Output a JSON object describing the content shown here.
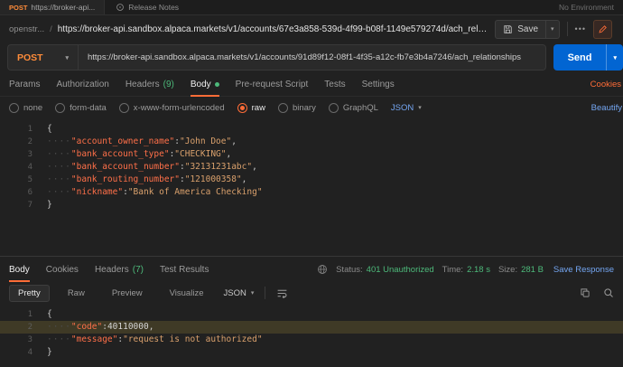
{
  "colors": {
    "accent_orange": "#ff6c37",
    "method_post": "#ff8c3a",
    "send_blue": "#0265d2",
    "link_blue": "#74a6f2",
    "success_green": "#4db97a",
    "editor_key": "#ff7049",
    "editor_string": "#d9a06c",
    "editor_number": "#d4d4d4",
    "highlight_line": "#3f3a26"
  },
  "icons": {
    "chevron_down": "▾",
    "more": "•••"
  },
  "topbar": {
    "tab_method": "POST",
    "tab_url": "https://broker-api...",
    "release_notes": "Release Notes",
    "environment": "No Environment"
  },
  "request_header": {
    "breadcrumb": "openstr...",
    "separator": "/",
    "title": "https://broker-api.sandbox.alpaca.markets/v1/accounts/67e3a858-539d-4f99-b08f-1149e579274d/ach_rela...",
    "save_label": "Save"
  },
  "url_bar": {
    "method": "POST",
    "url": "https://broker-api.sandbox.alpaca.markets/v1/accounts/91d89f12-08f1-4f35-a12c-fb7e3b4a7246/ach_relationships",
    "send_label": "Send"
  },
  "request_tabs": [
    {
      "label": "Params"
    },
    {
      "label": "Authorization"
    },
    {
      "label": "Headers",
      "count": "(9)"
    },
    {
      "label": "Body",
      "active": true,
      "dot": true
    },
    {
      "label": "Pre-request Script"
    },
    {
      "label": "Tests"
    },
    {
      "label": "Settings"
    }
  ],
  "cookies_link": "Cookies",
  "body_type_bar": {
    "options": [
      {
        "label": "none"
      },
      {
        "label": "form-data"
      },
      {
        "label": "x-www-form-urlencoded"
      },
      {
        "label": "raw",
        "selected": true
      },
      {
        "label": "binary"
      },
      {
        "label": "GraphQL"
      }
    ],
    "language": "JSON",
    "beautify": "Beautify"
  },
  "request_editor": {
    "lines": [
      {
        "num": 1,
        "indent": 0,
        "tokens": [
          [
            "punct",
            "{"
          ]
        ]
      },
      {
        "num": 2,
        "indent": 1,
        "tokens": [
          [
            "key",
            "\"account_owner_name\""
          ],
          [
            "punct",
            ": "
          ],
          [
            "str",
            "\"John Doe\""
          ],
          [
            "punct",
            ","
          ]
        ]
      },
      {
        "num": 3,
        "indent": 1,
        "tokens": [
          [
            "key",
            "\"bank_account_type\""
          ],
          [
            "punct",
            ": "
          ],
          [
            "str",
            "\"CHECKING\""
          ],
          [
            "punct",
            ","
          ]
        ]
      },
      {
        "num": 4,
        "indent": 1,
        "tokens": [
          [
            "key",
            "\"bank_account_number\""
          ],
          [
            "punct",
            ": "
          ],
          [
            "str",
            "\"32131231abc\""
          ],
          [
            "punct",
            ","
          ]
        ]
      },
      {
        "num": 5,
        "indent": 1,
        "tokens": [
          [
            "key",
            "\"bank_routing_number\""
          ],
          [
            "punct",
            ": "
          ],
          [
            "str",
            "\"121000358\""
          ],
          [
            "punct",
            ","
          ]
        ]
      },
      {
        "num": 6,
        "indent": 1,
        "tokens": [
          [
            "key",
            "\"nickname\""
          ],
          [
            "punct",
            ": "
          ],
          [
            "str",
            "\"Bank of America Checking\""
          ]
        ]
      },
      {
        "num": 7,
        "indent": 0,
        "tokens": [
          [
            "punct",
            "}"
          ]
        ]
      }
    ]
  },
  "response_tabs": [
    {
      "label": "Body",
      "active": true
    },
    {
      "label": "Cookies"
    },
    {
      "label": "Headers",
      "count": "(7)"
    },
    {
      "label": "Test Results"
    }
  ],
  "response_meta": {
    "status_label": "Status:",
    "status_value": "401 Unauthorized",
    "time_label": "Time:",
    "time_value": "2.18 s",
    "size_label": "Size:",
    "size_value": "281 B",
    "save_response": "Save Response"
  },
  "response_toolbar": {
    "views": [
      {
        "label": "Pretty",
        "active": true
      },
      {
        "label": "Raw"
      },
      {
        "label": "Preview"
      },
      {
        "label": "Visualize"
      }
    ],
    "language": "JSON"
  },
  "response_editor": {
    "lines": [
      {
        "num": 1,
        "indent": 0,
        "tokens": [
          [
            "punct",
            "{"
          ]
        ]
      },
      {
        "num": 2,
        "indent": 1,
        "highlight": true,
        "tokens": [
          [
            "key",
            "\"code\""
          ],
          [
            "punct",
            ": "
          ],
          [
            "num",
            "40110000"
          ],
          [
            "punct",
            ","
          ]
        ]
      },
      {
        "num": 3,
        "indent": 1,
        "tokens": [
          [
            "key",
            "\"message\""
          ],
          [
            "punct",
            ": "
          ],
          [
            "str",
            "\"request is not authorized\""
          ]
        ]
      },
      {
        "num": 4,
        "indent": 0,
        "tokens": [
          [
            "punct",
            "}"
          ]
        ]
      }
    ]
  }
}
